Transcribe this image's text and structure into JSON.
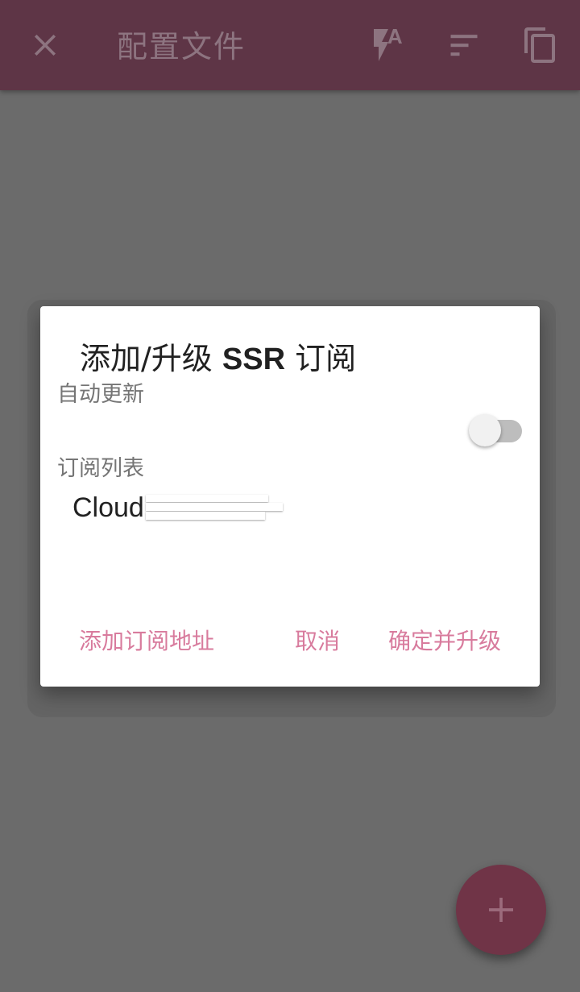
{
  "appbar": {
    "title": "配置文件",
    "icons": [
      "close-icon",
      "flash-auto-icon",
      "sort-icon",
      "copy-icon"
    ]
  },
  "dialog": {
    "title_prefix": "添加/升级 ",
    "title_bold": "SSR",
    "title_suffix": " 订阅",
    "auto_update_label": "自动更新",
    "auto_update_enabled": false,
    "subscription_list_label": "订阅列表",
    "subscriptions": [
      {
        "name": "Cloud"
      }
    ],
    "buttons": {
      "add_url": "添加订阅地址",
      "cancel": "取消",
      "confirm": "确定并升级"
    }
  },
  "fab": {
    "icon": "add-icon"
  },
  "colors": {
    "appbar": "#5e3546",
    "accent_text": "#d87b9d",
    "fab": "#703447",
    "overlay_background": "#6b6b6b"
  }
}
